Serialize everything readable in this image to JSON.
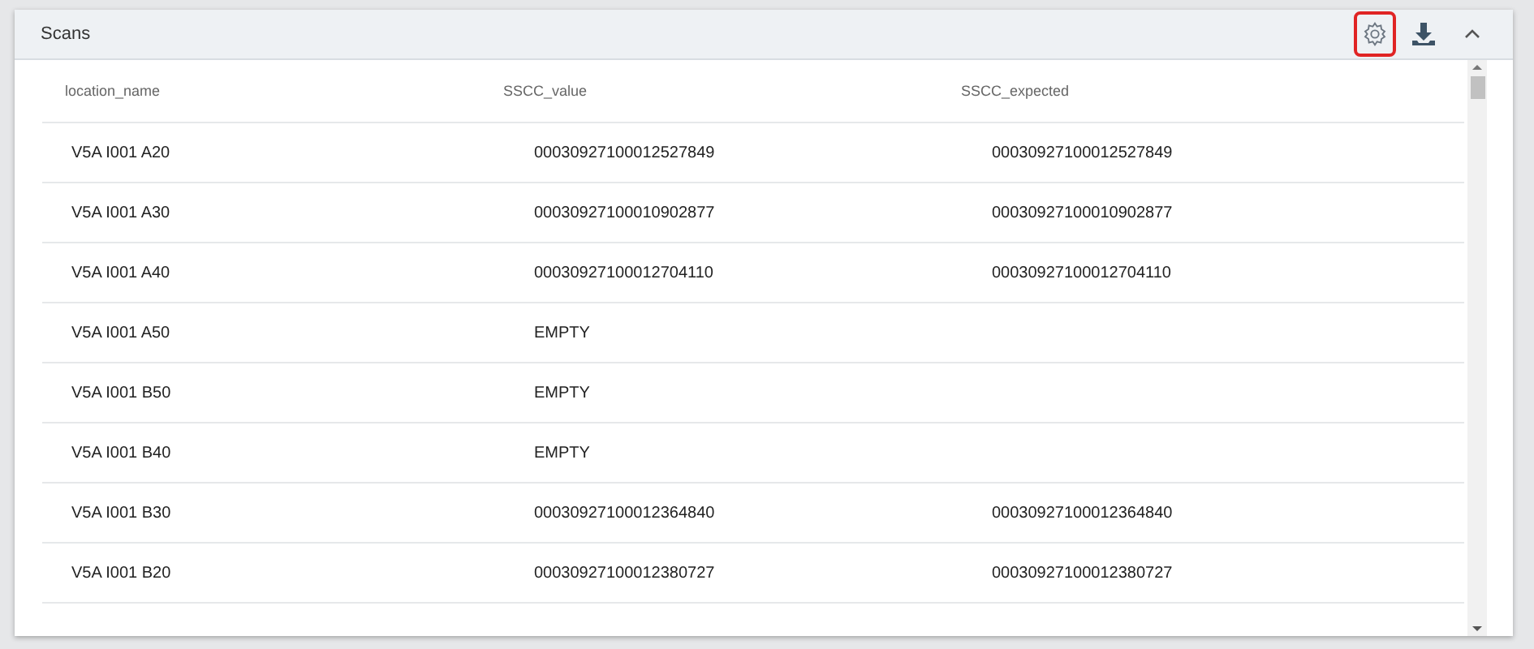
{
  "panel": {
    "title": "Scans",
    "toolbar": [
      {
        "kind": "settings",
        "highlighted": true
      },
      {
        "kind": "download",
        "highlighted": false
      },
      {
        "kind": "collapse",
        "highlighted": false
      }
    ]
  },
  "table": {
    "columns": [
      "location_name",
      "SSCC_value",
      "SSCC_expected"
    ],
    "rows": [
      [
        "V5A I001 A20",
        "00030927100012527849",
        "00030927100012527849"
      ],
      [
        "V5A I001 A30",
        "00030927100010902877",
        "00030927100010902877"
      ],
      [
        "V5A I001 A40",
        "00030927100012704110",
        "00030927100012704110"
      ],
      [
        "V5A I001 A50",
        "EMPTY",
        ""
      ],
      [
        "V5A I001 B50",
        "EMPTY",
        ""
      ],
      [
        "V5A I001 B40",
        "EMPTY",
        ""
      ],
      [
        "V5A I001 B30",
        "00030927100012364840",
        "00030927100012364840"
      ],
      [
        "V5A I001 B20",
        "00030927100012380727",
        "00030927100012380727"
      ]
    ]
  }
}
